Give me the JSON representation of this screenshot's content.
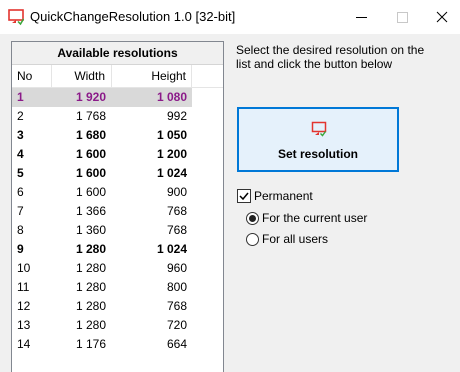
{
  "window": {
    "title": "QuickChangeResolution 1.0  [32-bit]",
    "app_icon": "monitor-refresh-icon"
  },
  "list": {
    "caption": "Available resolutions",
    "columns": [
      "No",
      "Width",
      "Height"
    ],
    "rows": [
      {
        "no": "1",
        "width": "1 920",
        "height": "1 080",
        "bold": true,
        "selected": true
      },
      {
        "no": "2",
        "width": "1 768",
        "height": "992",
        "bold": false,
        "selected": false
      },
      {
        "no": "3",
        "width": "1 680",
        "height": "1 050",
        "bold": true,
        "selected": false
      },
      {
        "no": "4",
        "width": "1 600",
        "height": "1 200",
        "bold": true,
        "selected": false
      },
      {
        "no": "5",
        "width": "1 600",
        "height": "1 024",
        "bold": true,
        "selected": false
      },
      {
        "no": "6",
        "width": "1 600",
        "height": "900",
        "bold": false,
        "selected": false
      },
      {
        "no": "7",
        "width": "1 366",
        "height": "768",
        "bold": false,
        "selected": false
      },
      {
        "no": "8",
        "width": "1 360",
        "height": "768",
        "bold": false,
        "selected": false
      },
      {
        "no": "9",
        "width": "1 280",
        "height": "1 024",
        "bold": true,
        "selected": false
      },
      {
        "no": "10",
        "width": "1 280",
        "height": "960",
        "bold": false,
        "selected": false
      },
      {
        "no": "11",
        "width": "1 280",
        "height": "800",
        "bold": false,
        "selected": false
      },
      {
        "no": "12",
        "width": "1 280",
        "height": "768",
        "bold": false,
        "selected": false
      },
      {
        "no": "13",
        "width": "1 280",
        "height": "720",
        "bold": false,
        "selected": false
      },
      {
        "no": "14",
        "width": "1 176",
        "height": "664",
        "bold": false,
        "selected": false
      }
    ]
  },
  "panel": {
    "instructions": "Select the desired resolution on the list and click the button below",
    "set_button": "Set resolution",
    "permanent_label": "Permanent",
    "permanent_checked": true,
    "radio_current_user": "For the current user",
    "radio_all_users": "For all users",
    "selected_scope": "current_user"
  },
  "colors": {
    "selected_row_text": "#8b1a89",
    "selected_row_bg": "#d9d9d9",
    "button_border": "#0078d7",
    "button_bg": "#e5f1fb",
    "icon_red": "#e3342f",
    "icon_green": "#3aa63a"
  }
}
